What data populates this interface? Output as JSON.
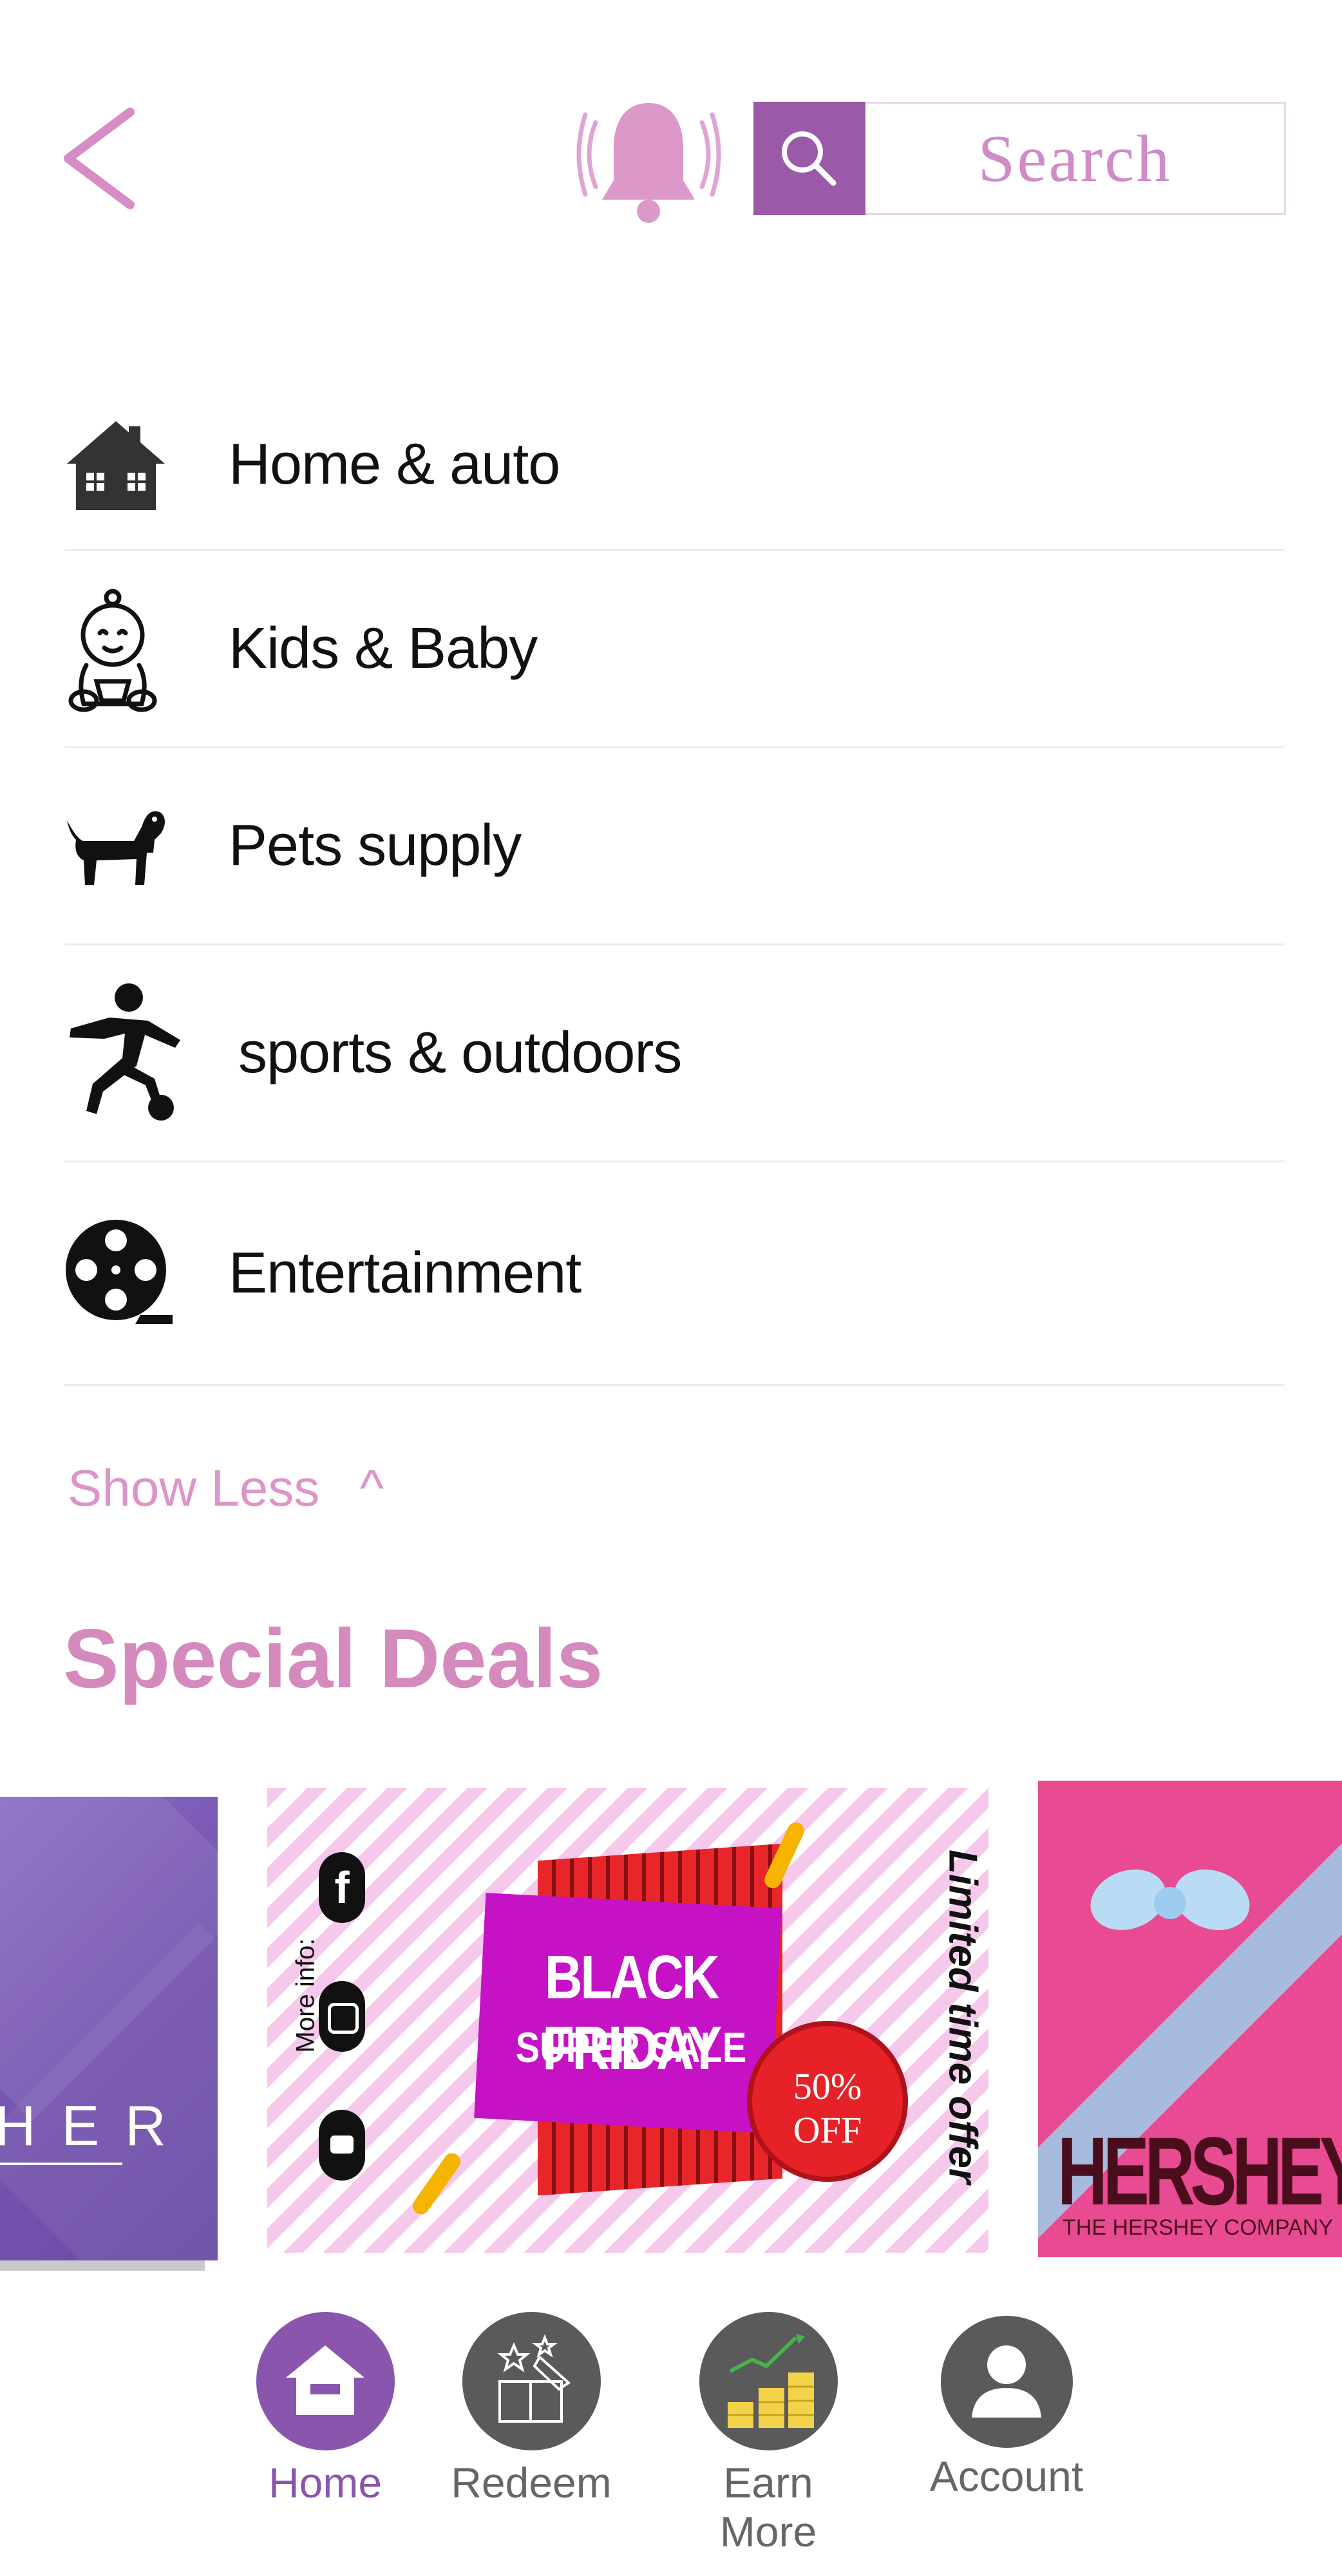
{
  "header": {
    "search_placeholder": "Search"
  },
  "categories": [
    {
      "label": "Home & auto",
      "icon": "house-icon"
    },
    {
      "label": "Kids & Baby",
      "icon": "baby-icon"
    },
    {
      "label": "Pets supply",
      "icon": "dog-icon"
    },
    {
      "label": "sports & outdoors",
      "icon": "soccer-player-icon"
    },
    {
      "label": "Entertainment",
      "icon": "film-reel-icon"
    }
  ],
  "show_less": "Show Less",
  "show_less_caret": "^",
  "special_deals": {
    "title": "Special Deals",
    "cards": [
      {
        "name": "voucher-card",
        "text": "HER"
      },
      {
        "name": "black-friday-card",
        "more_info": "More info:",
        "headline": "BLACK FRIDAY",
        "subline": "SUPER SALE",
        "badge_top": "50%",
        "badge_bottom": "OFF",
        "side_text": "Limited time offer"
      },
      {
        "name": "hershey-card",
        "brand": "HERSHEY",
        "company": "THE HERSHEY COMPANY"
      }
    ]
  },
  "bottom_nav": [
    {
      "label": "Home",
      "icon": "home-icon",
      "active": true
    },
    {
      "label": "Redeem",
      "icon": "gift-box-icon",
      "active": false
    },
    {
      "label": "Earn More",
      "icon": "coins-chart-icon",
      "active": false
    },
    {
      "label": "Account",
      "icon": "user-icon",
      "active": false
    }
  ],
  "colors": {
    "accent": "#d48abd",
    "active_nav": "#8a55ad",
    "inactive_nav": "#5a5a5a",
    "search_box": "#9a5aa8"
  }
}
